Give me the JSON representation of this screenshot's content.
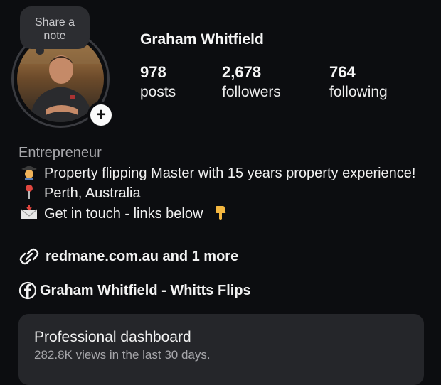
{
  "profile": {
    "note_bubble": "Share a note",
    "name": "Graham Whitfield",
    "avatar_icon": "profile-photo",
    "add_icon": "plus-icon"
  },
  "stats": [
    {
      "value": "978",
      "label": "posts"
    },
    {
      "value": "2,678",
      "label": "followers"
    },
    {
      "value": "764",
      "label": "following"
    }
  ],
  "bio": {
    "category": "Entrepreneur",
    "line1_icon": "graduate-emoji",
    "line1": "Property flipping Master with 15 years property experience!",
    "line2_icon": "pin-emoji",
    "line2": "Perth, Australia",
    "line3_icon": "envelope-emoji",
    "line3": "Get in touch - links below",
    "line3_trailing_icon": "pointing-down-emoji"
  },
  "links": {
    "link_icon": "link-icon",
    "link_text": "redmane.com.au and 1 more",
    "facebook_icon": "facebook-icon",
    "facebook_text": "Graham Whitfield - Whitts Flips"
  },
  "dashboard": {
    "title": "Professional dashboard",
    "subtitle": "282.8K views in the last 30 days."
  }
}
